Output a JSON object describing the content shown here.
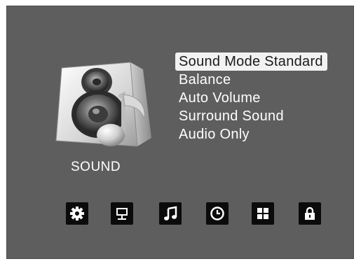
{
  "osd": {
    "category_label": "SOUND",
    "category_icon": "speaker-music-note-icon",
    "selected_index": 0,
    "menu_items": [
      {
        "label": "Sound Mode Standard"
      },
      {
        "label": "Balance"
      },
      {
        "label": "Auto Volume"
      },
      {
        "label": "Surround Sound"
      },
      {
        "label": "Audio Only"
      }
    ],
    "nav_icons": [
      "settings-gear-icon",
      "picture-monitor-icon",
      "music-note-icon",
      "clock-icon",
      "grid-icon",
      "lock-icon"
    ],
    "colors": {
      "background": "#5e5e5e",
      "highlight": "#f2f2f2",
      "icon_tile": "#0b0b0b",
      "text": "#ffffff"
    }
  }
}
